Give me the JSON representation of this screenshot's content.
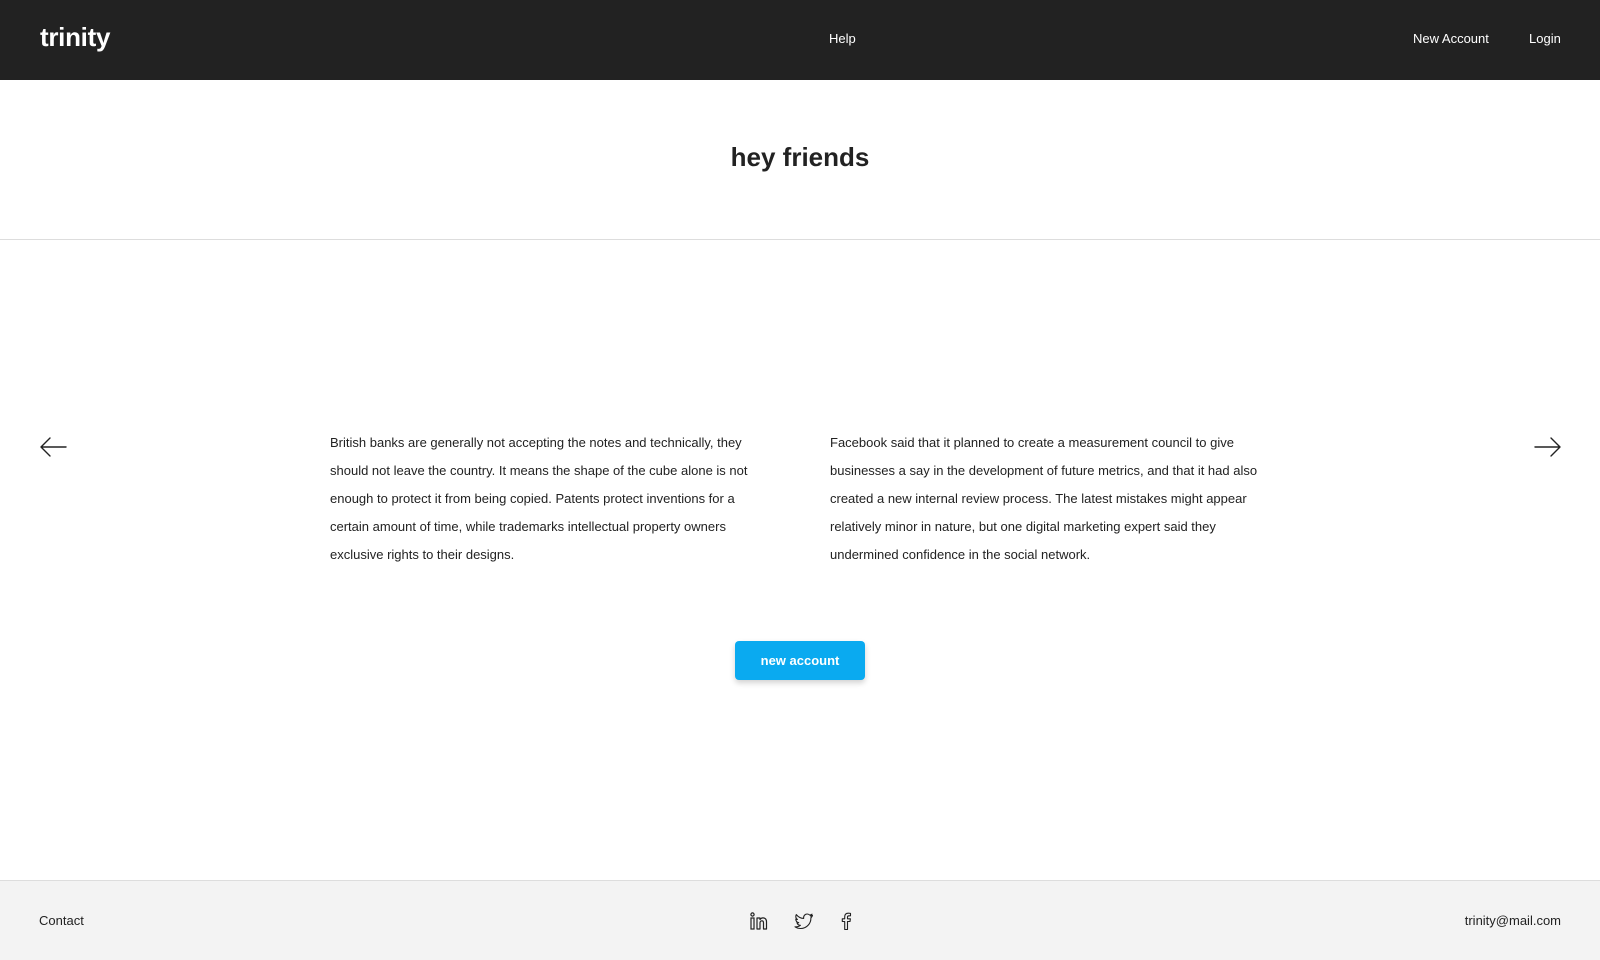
{
  "header": {
    "brand": "trinity",
    "nav": {
      "help": "Help",
      "new_account": "New Account",
      "login": "Login"
    }
  },
  "hero": {
    "title": "hey friends"
  },
  "carousel": {
    "prev_icon": "arrow-left-icon",
    "next_icon": "arrow-right-icon",
    "columns": [
      {
        "text": "British banks are generally not accepting the notes and technically, they should not leave the country. It means the shape of the cube alone is not enough to protect it from being copied. Patents protect inventions for a certain amount of time, while trademarks intellectual property owners exclusive rights to their designs."
      },
      {
        "text": "Facebook said that it planned to create a measurement council to give businesses a say in the development of future metrics, and that it had also created a new internal review process. The latest mistakes might appear relatively minor in nature, but one digital marketing expert said they undermined confidence in the social network."
      }
    ]
  },
  "cta": {
    "label": "new account",
    "color": "#0aaaf0"
  },
  "footer": {
    "contact": "Contact",
    "email": "trinity@mail.com",
    "social_icons": [
      "linkedin-icon",
      "twitter-icon",
      "facebook-icon"
    ]
  },
  "colors": {
    "topbar": "#222222",
    "footer": "#f3f3f3",
    "text": "#222222"
  }
}
